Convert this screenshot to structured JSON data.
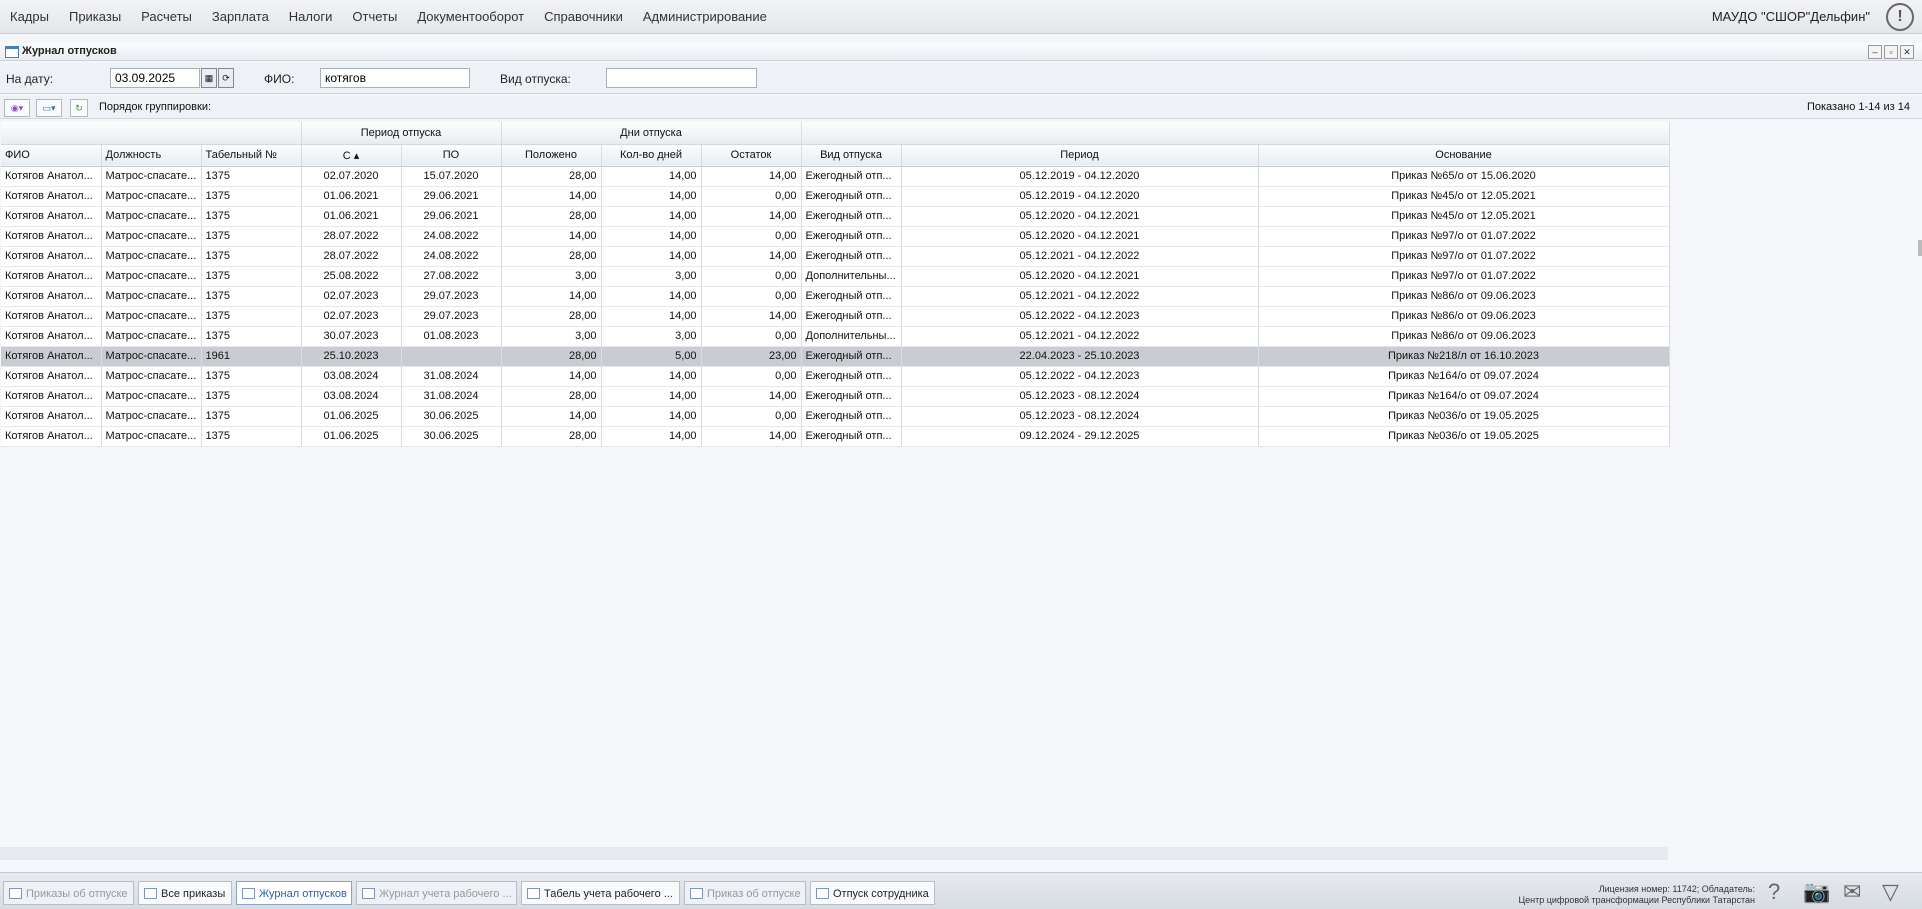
{
  "menu": {
    "items": [
      "Кадры",
      "Приказы",
      "Расчеты",
      "Зарплата",
      "Налоги",
      "Отчеты",
      "Документооборот",
      "Справочники",
      "Администрирование"
    ],
    "org": "МАУДО \"СШОР\"Дельфин\"",
    "alert_icon": "exclamation-icon",
    "alert_symbol": "!"
  },
  "window": {
    "title": "Журнал отпусков",
    "min": "–",
    "max": "▫",
    "close": "✕"
  },
  "filters": {
    "date_label": "На дату:",
    "date_value": "03.09.2025",
    "fio_label": "ФИО:",
    "fio_value": "котягов",
    "type_label": "Вид отпуска:",
    "type_value": ""
  },
  "toolbar": {
    "add_label": "◉▾",
    "print_label": "▭▾",
    "refresh_label": "↻",
    "grouping_label": "Порядок группировки:",
    "shown_text": "Показано 1-14 из 14"
  },
  "grid": {
    "group_headers": {
      "period": "Период отпуска",
      "days": "Дни отпуска"
    },
    "columns": [
      "ФИО",
      "Должность",
      "Табельный №",
      "С ▴",
      "ПО",
      "Положено",
      "Кол-во дней",
      "Остаток",
      "Вид отпуска",
      "Период",
      "Основание"
    ],
    "rows": [
      [
        "Котягов Анатол...",
        "Матрос-спасате...",
        "1375",
        "02.07.2020",
        "15.07.2020",
        "28,00",
        "14,00",
        "14,00",
        "Ежегодный отп...",
        "05.12.2019 - 04.12.2020",
        "Приказ №65/о от 15.06.2020"
      ],
      [
        "Котягов Анатол...",
        "Матрос-спасате...",
        "1375",
        "01.06.2021",
        "29.06.2021",
        "14,00",
        "14,00",
        "0,00",
        "Ежегодный отп...",
        "05.12.2019 - 04.12.2020",
        "Приказ №45/о от 12.05.2021"
      ],
      [
        "Котягов Анатол...",
        "Матрос-спасате...",
        "1375",
        "01.06.2021",
        "29.06.2021",
        "28,00",
        "14,00",
        "14,00",
        "Ежегодный отп...",
        "05.12.2020 - 04.12.2021",
        "Приказ №45/о от 12.05.2021"
      ],
      [
        "Котягов Анатол...",
        "Матрос-спасате...",
        "1375",
        "28.07.2022",
        "24.08.2022",
        "14,00",
        "14,00",
        "0,00",
        "Ежегодный отп...",
        "05.12.2020 - 04.12.2021",
        "Приказ №97/о от 01.07.2022"
      ],
      [
        "Котягов Анатол...",
        "Матрос-спасате...",
        "1375",
        "28.07.2022",
        "24.08.2022",
        "28,00",
        "14,00",
        "14,00",
        "Ежегодный отп...",
        "05.12.2021 - 04.12.2022",
        "Приказ №97/о от 01.07.2022"
      ],
      [
        "Котягов Анатол...",
        "Матрос-спасате...",
        "1375",
        "25.08.2022",
        "27.08.2022",
        "3,00",
        "3,00",
        "0,00",
        "Дополнительны...",
        "05.12.2020 - 04.12.2021",
        "Приказ №97/о от 01.07.2022"
      ],
      [
        "Котягов Анатол...",
        "Матрос-спасате...",
        "1375",
        "02.07.2023",
        "29.07.2023",
        "14,00",
        "14,00",
        "0,00",
        "Ежегодный отп...",
        "05.12.2021 - 04.12.2022",
        "Приказ №86/о от 09.06.2023"
      ],
      [
        "Котягов Анатол...",
        "Матрос-спасате...",
        "1375",
        "02.07.2023",
        "29.07.2023",
        "28,00",
        "14,00",
        "14,00",
        "Ежегодный отп...",
        "05.12.2022 - 04.12.2023",
        "Приказ №86/о от 09.06.2023"
      ],
      [
        "Котягов Анатол...",
        "Матрос-спасате...",
        "1375",
        "30.07.2023",
        "01.08.2023",
        "3,00",
        "3,00",
        "0,00",
        "Дополнительны...",
        "05.12.2021 - 04.12.2022",
        "Приказ №86/о от 09.06.2023"
      ],
      [
        "Котягов Анатол...",
        "Матрос-спасате...",
        "1961",
        "25.10.2023",
        "",
        "28,00",
        "5,00",
        "23,00",
        "Ежегодный отп...",
        "22.04.2023 - 25.10.2023",
        "Приказ №218/л от 16.10.2023"
      ],
      [
        "Котягов Анатол...",
        "Матрос-спасате...",
        "1375",
        "03.08.2024",
        "31.08.2024",
        "14,00",
        "14,00",
        "0,00",
        "Ежегодный отп...",
        "05.12.2022 - 04.12.2023",
        "Приказ №164/о от 09.07.2024"
      ],
      [
        "Котягов Анатол...",
        "Матрос-спасате...",
        "1375",
        "03.08.2024",
        "31.08.2024",
        "28,00",
        "14,00",
        "14,00",
        "Ежегодный отп...",
        "05.12.2023 - 08.12.2024",
        "Приказ №164/о от 09.07.2024"
      ],
      [
        "Котягов Анатол...",
        "Матрос-спасате...",
        "1375",
        "01.06.2025",
        "30.06.2025",
        "14,00",
        "14,00",
        "0,00",
        "Ежегодный отп...",
        "05.12.2023 - 08.12.2024",
        "Приказ №036/о от 19.05.2025"
      ],
      [
        "Котягов Анатол...",
        "Матрос-спасате...",
        "1375",
        "01.06.2025",
        "30.06.2025",
        "28,00",
        "14,00",
        "14,00",
        "Ежегодный отп...",
        "09.12.2024 - 29.12.2025",
        "Приказ №036/о от 19.05.2025"
      ]
    ]
  },
  "taskbar": {
    "tabs": [
      "Приказы об отпуске",
      "Все приказы",
      "Журнал отпусков",
      "Журнал учета рабочего ...",
      "Табель учета рабочего ...",
      "Приказ об отпуске",
      "Отпуск сотрудника"
    ],
    "license_line1": "Лицензия номер: 11742; Обладатель:",
    "license_line2": "Центр цифровой трансформации Республики Татарстан",
    "icons": {
      "help": "?",
      "camera": "📷",
      "mail": "✉",
      "collapse": "▽"
    }
  }
}
